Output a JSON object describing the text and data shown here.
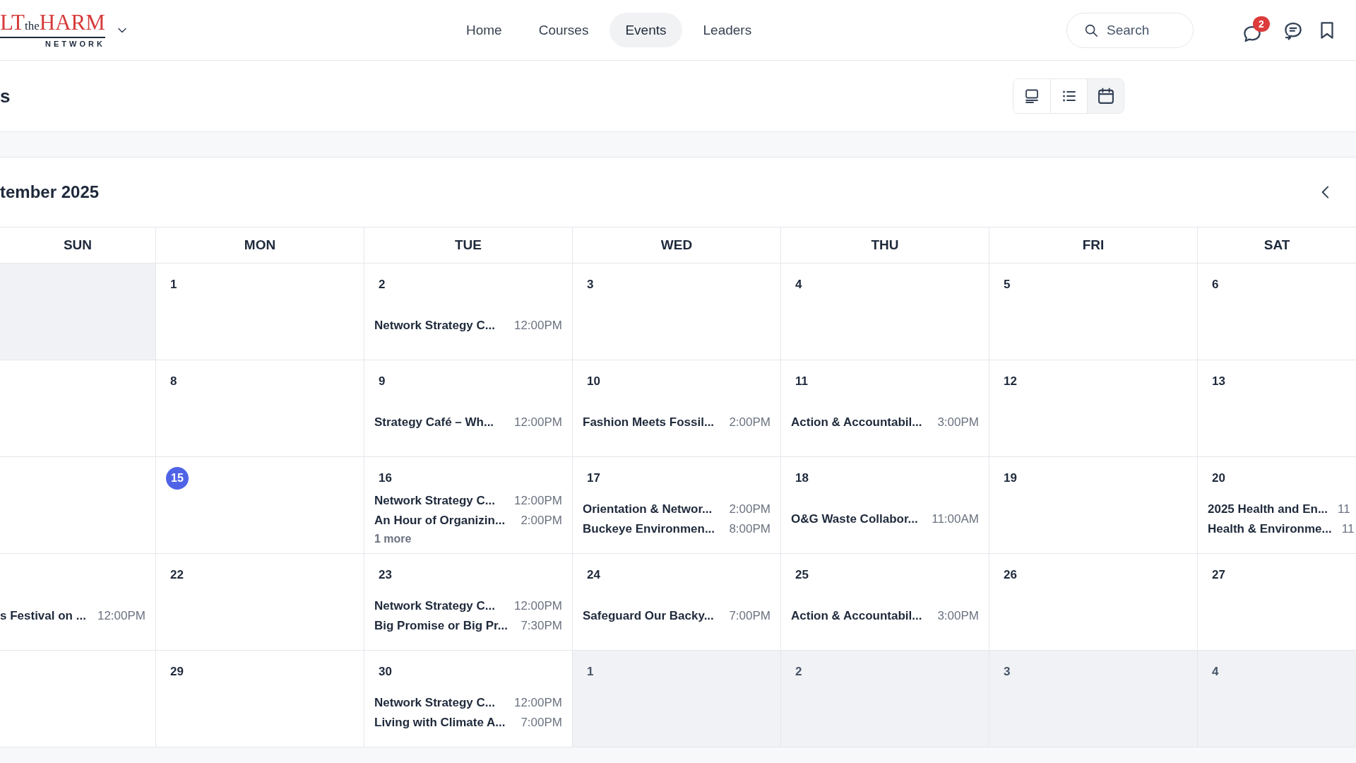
{
  "header": {
    "logo": {
      "lead": "LT",
      "small": "the",
      "main": "HARM",
      "sub": "NETWORK"
    },
    "nav": [
      {
        "label": "Home",
        "selected": false
      },
      {
        "label": "Courses",
        "selected": false
      },
      {
        "label": "Events",
        "selected": true
      },
      {
        "label": "Leaders",
        "selected": false
      }
    ],
    "search": {
      "placeholder": "Search"
    },
    "notification_count": "2"
  },
  "page_title": "s",
  "view_modes": [
    {
      "kind": "board",
      "selected": false
    },
    {
      "kind": "list",
      "selected": false
    },
    {
      "kind": "calendar",
      "selected": true
    }
  ],
  "calendar": {
    "month": "tember 2025",
    "weekdays": [
      "SUN",
      "MON",
      "TUE",
      "WED",
      "THU",
      "FRI",
      "SAT"
    ],
    "weeks": [
      {
        "days": [
          {
            "outside": true
          },
          {
            "date": "1",
            "outside": false,
            "today": false
          },
          {
            "date": "2",
            "outside": false,
            "today": false,
            "events": [
              {
                "title": "Network Strategy C...",
                "time": "12:00PM"
              }
            ]
          },
          {
            "date": "3",
            "outside": false,
            "today": false
          },
          {
            "date": "4",
            "outside": false,
            "today": false
          },
          {
            "date": "5",
            "outside": false,
            "today": false
          },
          {
            "date": "6",
            "outside": false,
            "today": false
          }
        ]
      },
      {
        "days": [
          {
            "outside": false
          },
          {
            "date": "8",
            "outside": false,
            "today": false
          },
          {
            "date": "9",
            "outside": false,
            "today": false,
            "events": [
              {
                "title": "Strategy Café – Wh...",
                "time": "12:00PM"
              }
            ]
          },
          {
            "date": "10",
            "outside": false,
            "today": false,
            "events": [
              {
                "title": "Fashion Meets Fossil...",
                "time": "2:00PM"
              }
            ]
          },
          {
            "date": "11",
            "outside": false,
            "today": false,
            "events": [
              {
                "title": "Action & Accountabil...",
                "time": "3:00PM"
              }
            ]
          },
          {
            "date": "12",
            "outside": false,
            "today": false
          },
          {
            "date": "13",
            "outside": false,
            "today": false
          }
        ]
      },
      {
        "days": [
          {
            "outside": false
          },
          {
            "date": "15",
            "outside": false,
            "today": true
          },
          {
            "date": "16",
            "outside": false,
            "today": false,
            "events": [
              {
                "title": "Network Strategy C...",
                "time": "12:00PM"
              },
              {
                "title": "An Hour of Organizin...",
                "time": "2:00PM"
              }
            ],
            "more": "1 more"
          },
          {
            "date": "17",
            "outside": false,
            "today": false,
            "events": [
              {
                "title": "Orientation & Networ...",
                "time": "2:00PM"
              },
              {
                "title": "Buckeye Environmen...",
                "time": "8:00PM"
              }
            ]
          },
          {
            "date": "18",
            "outside": false,
            "today": false,
            "events": [
              {
                "title": "O&G Waste Collabor...",
                "time": "11:00AM"
              }
            ]
          },
          {
            "date": "19",
            "outside": false,
            "today": false
          },
          {
            "date": "20",
            "outside": false,
            "today": false,
            "events": [
              {
                "title": "2025 Health and En...",
                "time": "11"
              },
              {
                "title": "Health & Environme...",
                "time": "11"
              }
            ]
          }
        ]
      },
      {
        "days": [
          {
            "outside": false,
            "events": [
              {
                "title": "s Festival on ...",
                "time": "12:00PM"
              }
            ]
          },
          {
            "date": "22",
            "outside": false,
            "today": false
          },
          {
            "date": "23",
            "outside": false,
            "today": false,
            "events": [
              {
                "title": "Network Strategy C...",
                "time": "12:00PM"
              },
              {
                "title": "Big Promise or Big Pr...",
                "time": "7:30PM"
              }
            ]
          },
          {
            "date": "24",
            "outside": false,
            "today": false,
            "events": [
              {
                "title": "Safeguard Our Backy...",
                "time": "7:00PM"
              }
            ]
          },
          {
            "date": "25",
            "outside": false,
            "today": false,
            "events": [
              {
                "title": "Action & Accountabil...",
                "time": "3:00PM"
              }
            ]
          },
          {
            "date": "26",
            "outside": false,
            "today": false
          },
          {
            "date": "27",
            "outside": false,
            "today": false
          }
        ]
      },
      {
        "days": [
          {
            "outside": false
          },
          {
            "date": "29",
            "outside": false,
            "today": false
          },
          {
            "date": "30",
            "outside": false,
            "today": false,
            "events": [
              {
                "title": "Network Strategy C...",
                "time": "12:00PM"
              },
              {
                "title": "Living with Climate A...",
                "time": "7:00PM"
              }
            ]
          },
          {
            "date": "1",
            "outside": true,
            "today": false
          },
          {
            "date": "2",
            "outside": true,
            "today": false
          },
          {
            "date": "3",
            "outside": true,
            "today": false
          },
          {
            "date": "4",
            "outside": true,
            "today": false
          }
        ]
      }
    ]
  }
}
